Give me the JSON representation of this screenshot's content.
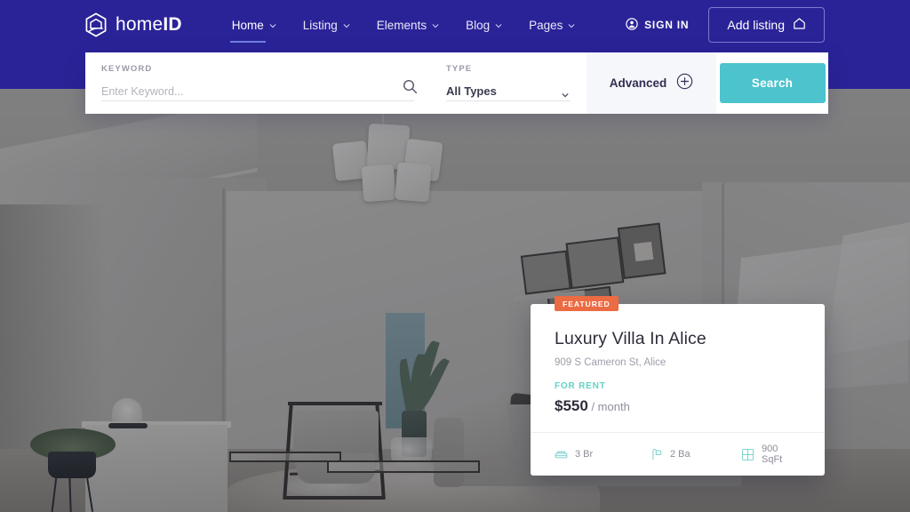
{
  "brand": {
    "name_light": "home",
    "name_bold": "ID",
    "logo_icon": "hexagon-house-icon"
  },
  "nav": {
    "items": [
      {
        "label": "Home",
        "active": true,
        "has_caret": true
      },
      {
        "label": "Listing",
        "active": false,
        "has_caret": true
      },
      {
        "label": "Elements",
        "active": false,
        "has_caret": true
      },
      {
        "label": "Blog",
        "active": false,
        "has_caret": true
      },
      {
        "label": "Pages",
        "active": false,
        "has_caret": true
      }
    ],
    "sign_in": "SIGN IN",
    "sign_in_icon": "user-circle-icon",
    "add_listing": "Add listing",
    "add_listing_icon": "home-outline-icon"
  },
  "search": {
    "keyword_label": "KEYWORD",
    "keyword_placeholder": "Enter Keyword...",
    "keyword_value": "",
    "search_icon": "magnifier-icon",
    "type_label": "TYPE",
    "type_value": "All Types",
    "type_caret_icon": "chevron-down-icon",
    "advanced_label": "Advanced",
    "advanced_icon": "plus-circle-icon",
    "search_button": "Search"
  },
  "card": {
    "badge": "FEATURED",
    "title": "Luxury Villa In Alice",
    "address": "909 S Cameron St, Alice",
    "status": "FOR RENT",
    "price": "$550",
    "price_period": "/ month",
    "amenities": [
      {
        "value": "3 Br",
        "icon": "bed-icon"
      },
      {
        "value": "2 Ba",
        "icon": "shower-icon"
      },
      {
        "value": "900 SqFt",
        "icon": "area-grid-icon"
      }
    ]
  },
  "colors": {
    "navy": "#2a2398",
    "teal": "#4cc3cd",
    "badge_orange": "#ec6b42",
    "rent_green": "#63d3c6"
  }
}
